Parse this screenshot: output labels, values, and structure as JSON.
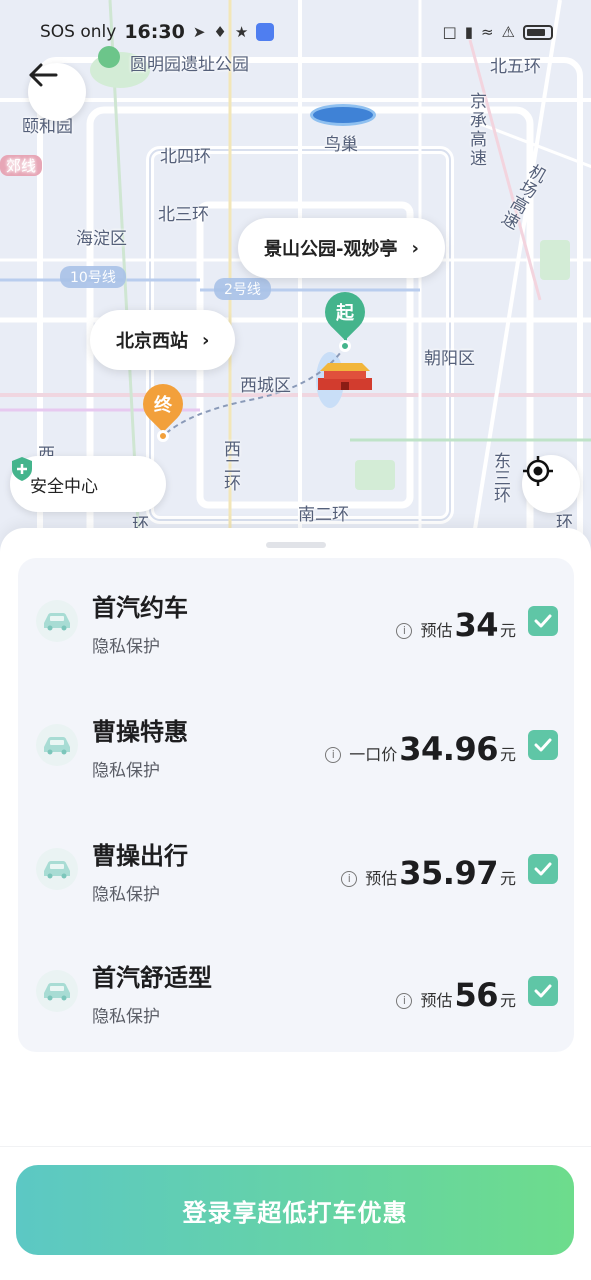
{
  "status_bar": {
    "carrier": "SOS only",
    "time": "16:30"
  },
  "map": {
    "labels": {
      "park": "圆明园遗址公园",
      "yiheyuan": "颐和园",
      "line_tag": "郊线",
      "niaochao": "鸟巢",
      "beiwuhuan": "北五环",
      "beisihuan": "北四环",
      "beisanhuan": "北三环",
      "haidian": "海淀区",
      "line10": "10号线",
      "line2": "2号线",
      "xicheng": "西城区",
      "chaoyang": "朝阳区",
      "jingcheng": "京承高速",
      "jichang": "机场高速",
      "xierhuan": "西二环",
      "nanerhuan": "南二环",
      "dongsanhuan": "东三环",
      "xi": "西",
      "huan_left": "环",
      "huan_right": "环"
    },
    "start_place": "景山公园-观妙亭",
    "end_place": "北京西站",
    "start_marker": "起",
    "end_marker": "终",
    "safety_center": "安全中心"
  },
  "rides": [
    {
      "name": "首汽约车",
      "sub": "隐私保护",
      "price_label": "预估",
      "price": "34",
      "unit": "元",
      "checked": true
    },
    {
      "name": "曹操特惠",
      "sub": "隐私保护",
      "price_label": "一口价",
      "price": "34.96",
      "unit": "元",
      "checked": true
    },
    {
      "name": "曹操出行",
      "sub": "隐私保护",
      "price_label": "预估",
      "price": "35.97",
      "unit": "元",
      "checked": true
    },
    {
      "name": "首汽舒适型",
      "sub": "隐私保护",
      "price_label": "预估",
      "price": "56",
      "unit": "元",
      "checked": true
    }
  ],
  "footer": {
    "login_label": "登录享超低打车优惠"
  },
  "colors": {
    "accent_green": "#5fc6a6",
    "start_pin": "#44b48c",
    "end_pin": "#f2a03b",
    "button_gradient_start": "#5cc8c4",
    "button_gradient_end": "#6ddc8c"
  }
}
